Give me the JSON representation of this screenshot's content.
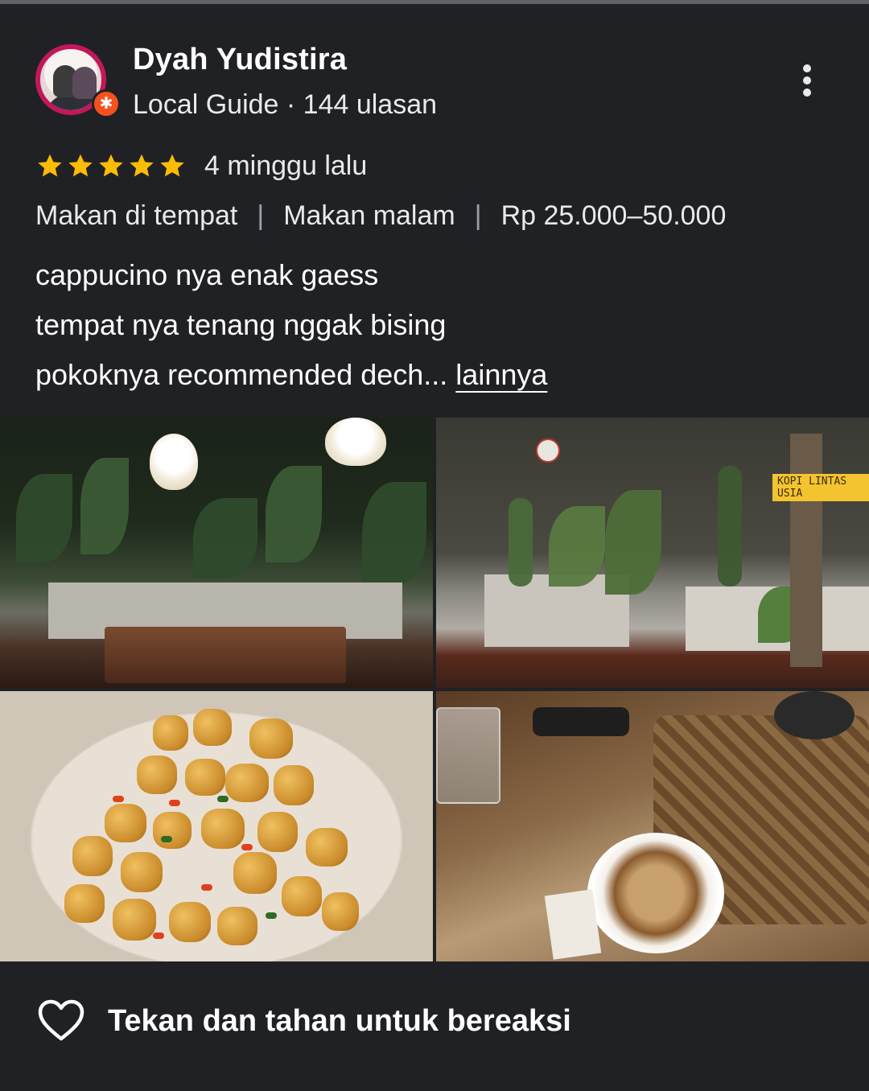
{
  "reviewer": {
    "name": "Dyah Yudistira",
    "meta": "Local Guide · 144 ulasan",
    "avatar_icon": "user-avatar",
    "badge_icon": "local-guide-badge-icon"
  },
  "menu_icon": "more-vert-icon",
  "rating": {
    "stars": 5,
    "max": 5,
    "star_color": "#fbbc04",
    "time": "4 minggu lalu"
  },
  "tags": [
    "Makan di tempat",
    "Makan malam",
    "Rp 25.000–50.000"
  ],
  "tag_separator": "|",
  "review": {
    "lines": [
      "cappucino nya enak gaess",
      "tempat nya tenang nggak bising",
      "pokoknya recommended dech..."
    ],
    "more_label": "lainnya"
  },
  "photos": [
    {
      "name": "photo-garden-seating"
    },
    {
      "name": "photo-interior-wall",
      "sign_text": "KOPI LINTAS USIA"
    },
    {
      "name": "photo-fried-tofu"
    },
    {
      "name": "photo-cappuccino"
    }
  ],
  "footer": {
    "react_icon": "heart-outline-icon",
    "react_label": "Tekan dan tahan untuk bereaksi"
  }
}
